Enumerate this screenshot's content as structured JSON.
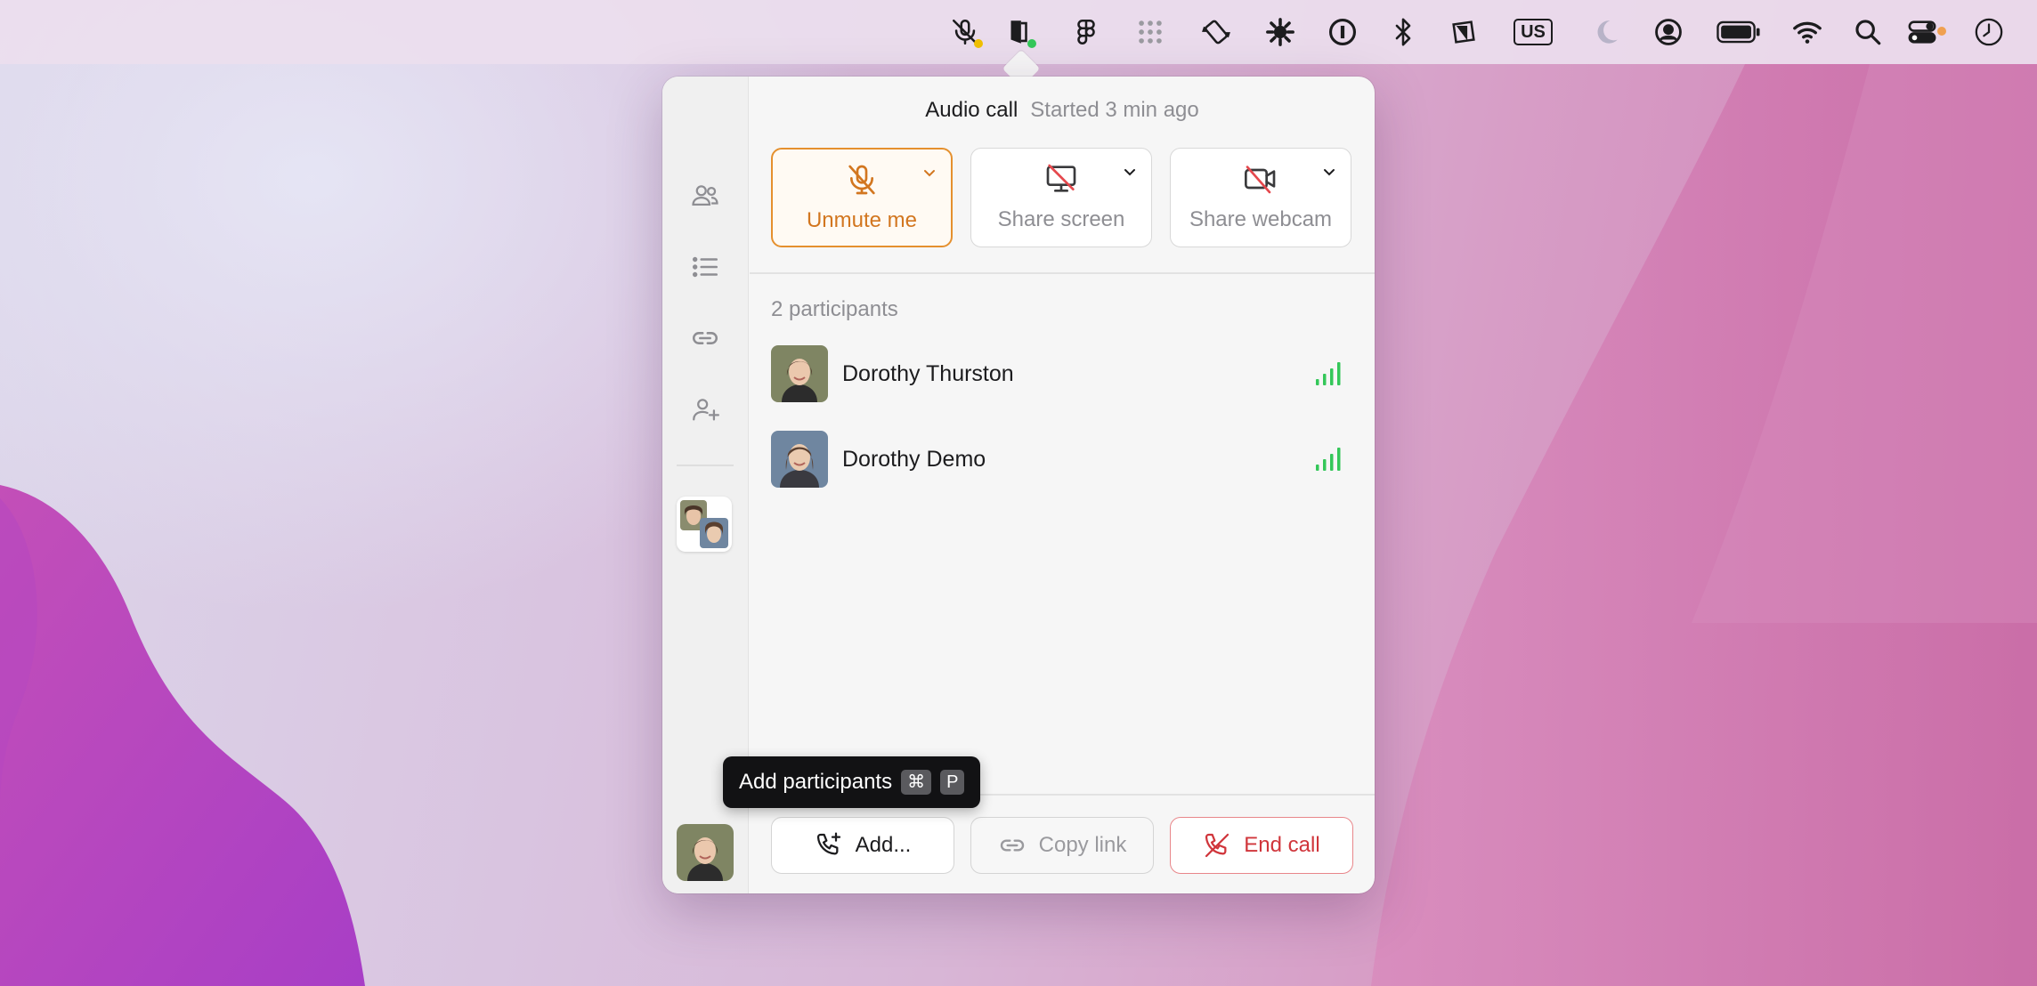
{
  "menubar": {
    "icons": [
      "mic-muted-icon",
      "call-app-icon",
      "figma-icon",
      "grid-dots-icon",
      "rotate-device-icon",
      "asterisk-icon",
      "password-manager-icon",
      "bluetooth-icon",
      "shapes-app-icon",
      "keyboard-input-icon",
      "moon-icon",
      "user-account-icon",
      "battery-icon",
      "wifi-icon",
      "search-icon",
      "control-center-icon",
      "clock-icon"
    ],
    "input_source": "US",
    "mic_dot_color": "#f0c000",
    "call_dot_color": "#34c759",
    "control_dot_color": "#f0a050"
  },
  "call": {
    "title": "Audio call",
    "status": "Started 3 min ago",
    "controls": {
      "unmute_label": "Unmute me",
      "share_screen_label": "Share screen",
      "share_webcam_label": "Share webcam"
    },
    "participants_count_label": "2 participants",
    "participants": [
      {
        "name": "Dorothy Thurston"
      },
      {
        "name": "Dorothy Demo"
      }
    ],
    "footer": {
      "add_label": "Add...",
      "copy_label": "Copy link",
      "end_label": "End call"
    },
    "tooltip": {
      "label": "Add participants",
      "key1": "⌘",
      "key2": "P"
    },
    "accent_color": "#e5902e",
    "danger_color": "#d0353b",
    "signal_color": "#34c759"
  }
}
